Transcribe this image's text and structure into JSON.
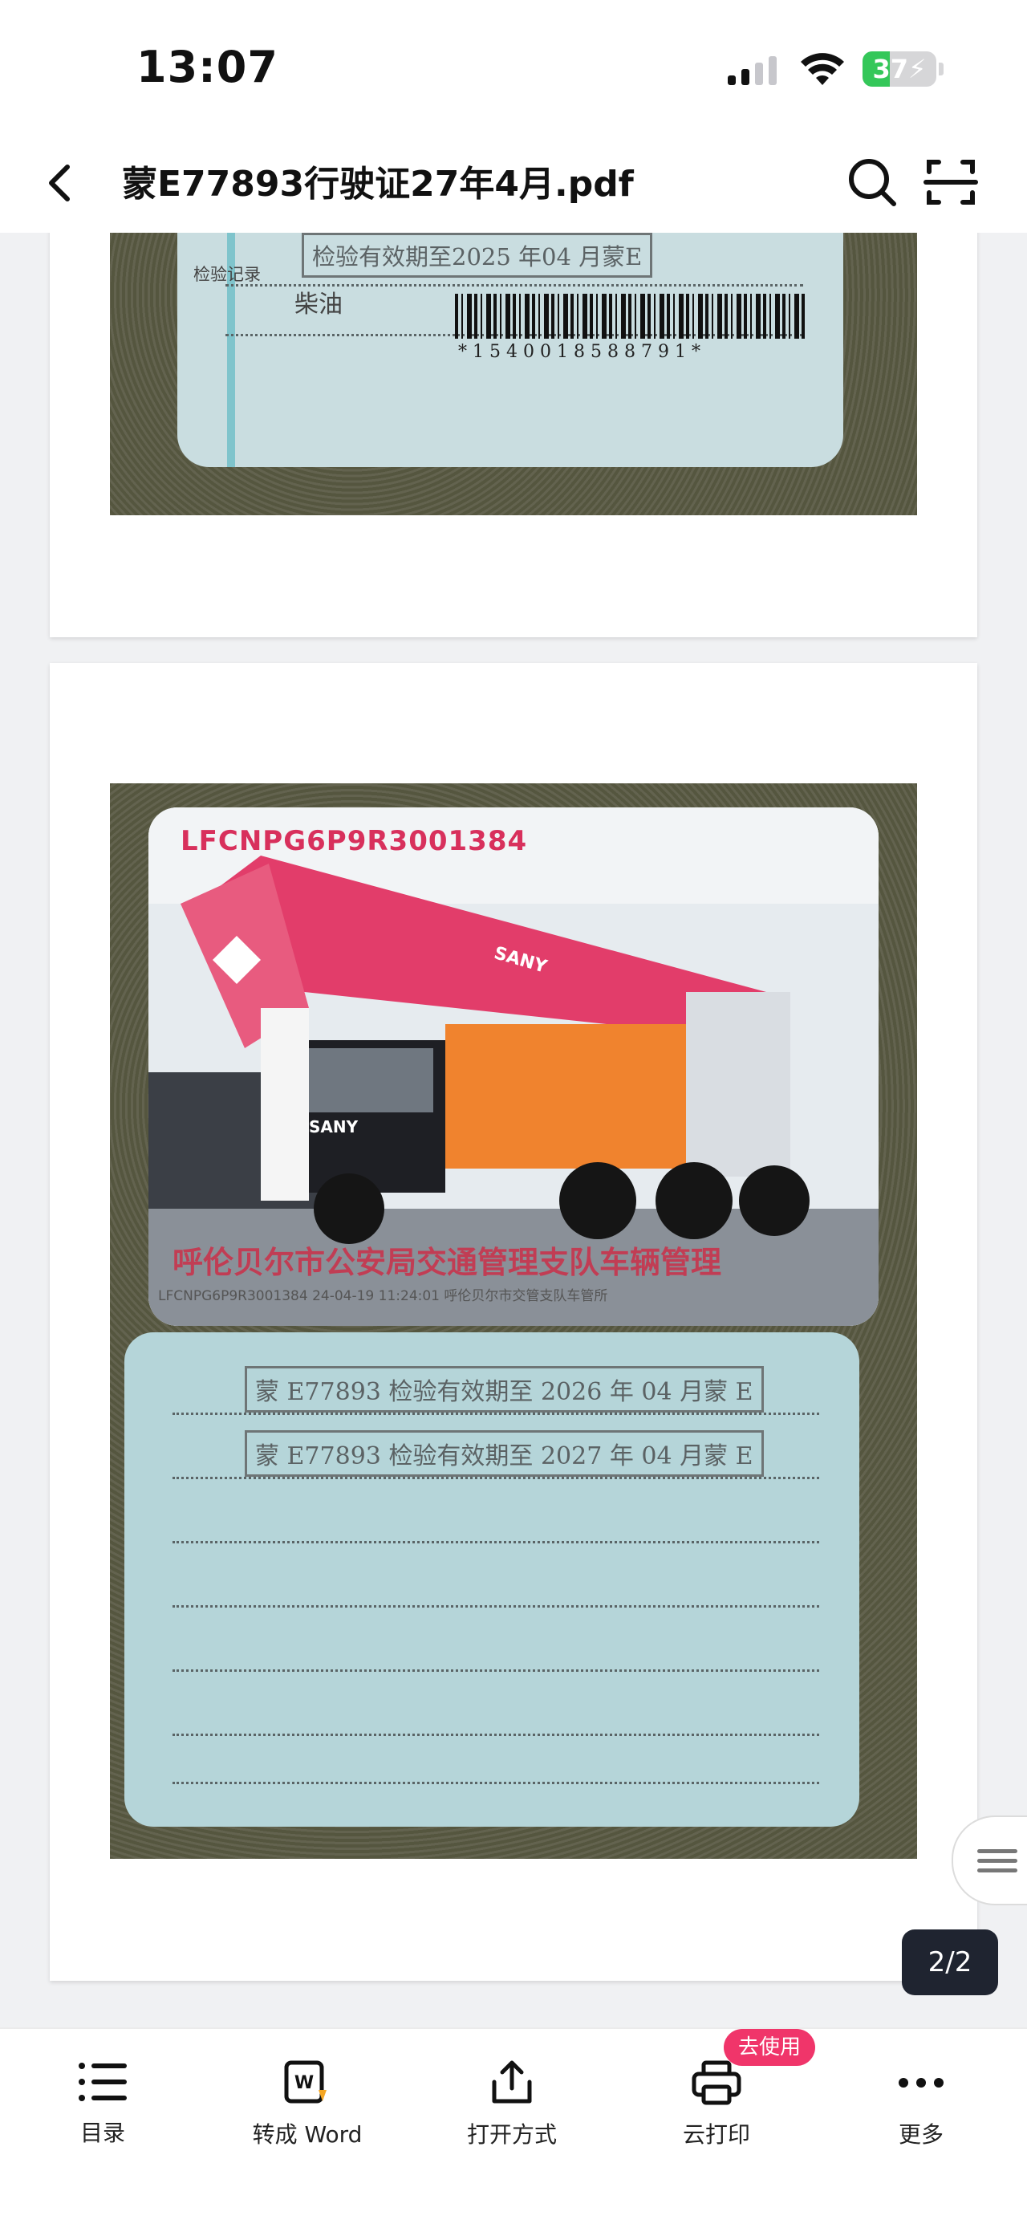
{
  "status_bar": {
    "time": "13:07",
    "battery": "37",
    "battery_level": 0.37
  },
  "header": {
    "title": "蒙E77893行驶证27年4月.pdf"
  },
  "page1": {
    "stamp_text": "检验有效期至2025 年04 月蒙E",
    "label_record": "检验记录",
    "fuel": "柴油",
    "barcode_number": "*1540018588791*"
  },
  "page2": {
    "vin": "LFCNPG6P9R3001384",
    "authority": "呼伦贝尔市公安局交通管理支队车辆管理",
    "photo_footer": "LFCNPG6P9R3001384 24-04-19 11:24:01 呼伦贝尔市交管支队车管所",
    "brand_boom": "SANY",
    "brand_cab": "SANY",
    "stamps": [
      "蒙 E77893 检验有效期至 2026 年 04 月蒙 E",
      "蒙 E77893 检验有效期至 2027 年 04 月蒙 E"
    ]
  },
  "page_indicator": "2/2",
  "toolbar": {
    "items": [
      {
        "label": "目录",
        "icon": "list-icon"
      },
      {
        "label": "转成 Word",
        "icon": "word-icon"
      },
      {
        "label": "打开方式",
        "icon": "share-icon"
      },
      {
        "label": "云打印",
        "icon": "printer-icon",
        "badge": "去使用"
      },
      {
        "label": "更多",
        "icon": "more-icon"
      }
    ]
  },
  "colors": {
    "accent_badge": "#f0356a",
    "battery": "#34c759",
    "page_badge_bg": "#1f2430"
  }
}
